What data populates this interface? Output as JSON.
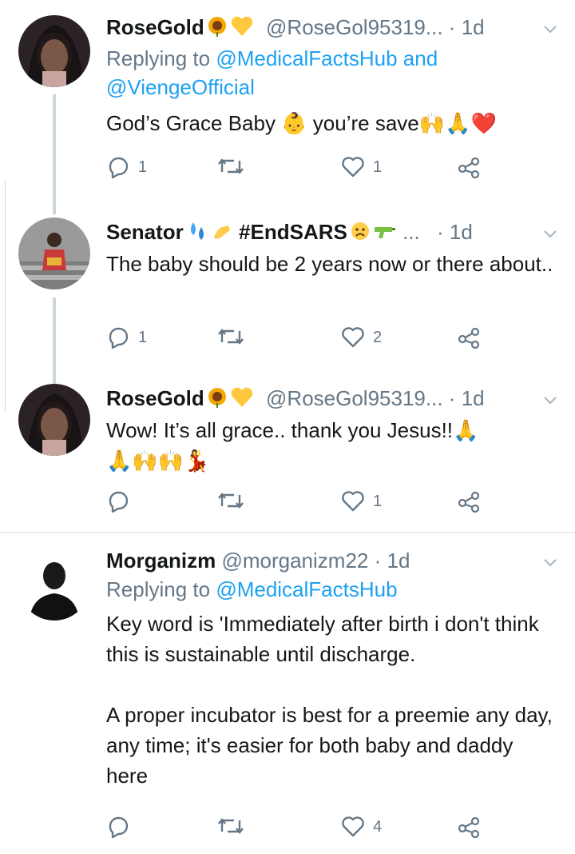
{
  "tweets": [
    {
      "name": "RoseGold",
      "handle": "@RoseGol95319...",
      "sep": "·",
      "time": "1d",
      "reply_prefix": "Replying to ",
      "reply_targets": "@MedicalFactsHub and @ViengeOfficial",
      "text": "God’s Grace Baby 👶 you’re save🙌🙏❤️",
      "replies": "1",
      "retweets": "",
      "likes": "1"
    },
    {
      "name": "Senator",
      "name_suffix": " #EndSARS",
      "handle": "...",
      "sep": "·",
      "time": "1d",
      "text": "The baby should be 2 years now or there about..",
      "replies": "1",
      "retweets": "",
      "likes": "2"
    },
    {
      "name": "RoseGold",
      "handle": "@RoseGol95319...",
      "sep": "·",
      "time": "1d",
      "text": "Wow! It’s all grace.. thank you Jesus!!🙏\n🙏🙌🙌💃",
      "replies": "",
      "retweets": "",
      "likes": "1"
    },
    {
      "name": "Morganizm",
      "handle": "@morganizm22",
      "sep": "·",
      "time": "1d",
      "reply_prefix": "Replying to ",
      "reply_targets": "@MedicalFactsHub",
      "text": "Key word is 'Immediately after birth i don't think this is sustainable until discharge.\n\nA proper incubator is best for a preemie any day, any time; it's easier for both baby and daddy here",
      "replies": "",
      "retweets": "",
      "likes": "4"
    }
  ],
  "colors": {
    "accent": "#1da1f2",
    "muted": "#657786",
    "text": "#14171a"
  },
  "icons": [
    "reply-icon",
    "retweet-icon",
    "like-icon",
    "share-icon",
    "caret-down-icon"
  ]
}
